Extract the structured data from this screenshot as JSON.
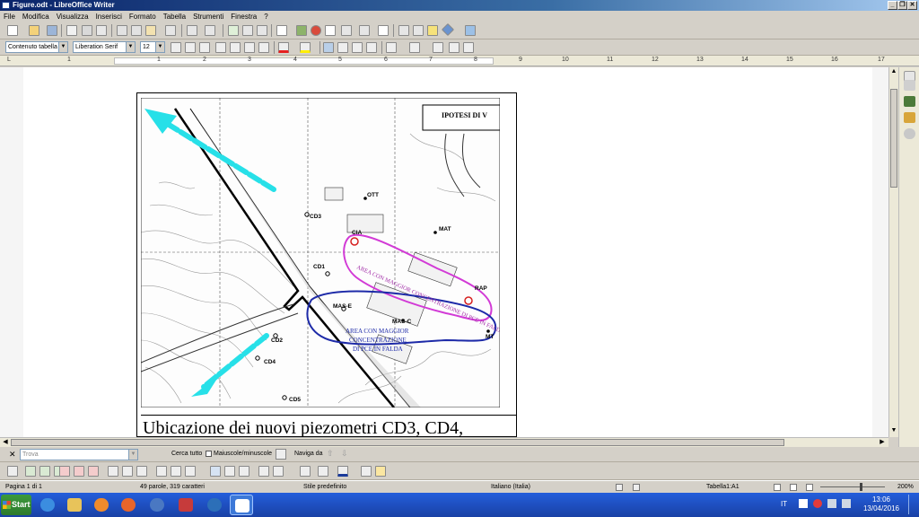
{
  "window": {
    "title": "Figure.odt - LibreOffice Writer",
    "minimize_label": "_",
    "maximize_label": "❐",
    "close_label": "✕"
  },
  "menu": [
    "File",
    "Modifica",
    "Visualizza",
    "Inserisci",
    "Formato",
    "Tabella",
    "Strumenti",
    "Finestra",
    "?"
  ],
  "formatting": {
    "paragraph_style": "Contenuto tabella",
    "font_name": "Liberation Serif",
    "font_size": "12"
  },
  "ruler": {
    "numbers": [
      "1",
      "1",
      "2",
      "3",
      "4",
      "5",
      "6",
      "7",
      "8",
      "9",
      "10",
      "11",
      "12",
      "13",
      "14",
      "15",
      "16",
      "17"
    ]
  },
  "document": {
    "caption": "Ubicazione dei nuovi piezometri CD3, CD4,",
    "map": {
      "header_label": "IPOTESI DI V",
      "wells": [
        "OTT",
        "CD3",
        "CIA",
        "MAT",
        "CD1",
        "RAP",
        "MAS-E",
        "MAS-C",
        "CD2",
        "CD4",
        "CD5",
        "MT"
      ],
      "purple_area_label": "AREA CON MAGGIOR CONCENTRAZIONE DI PCE IN FALDA",
      "blue_area_label_1": "AREA CON MAGGIOR",
      "blue_area_label_2": "CONCENTRAZIONE",
      "blue_area_label_3": "DI PCE IN FALDA"
    }
  },
  "findbar": {
    "placeholder": "Trova",
    "find_all": "Cerca tutto",
    "match_case": "Maiuscole/minuscole",
    "navigate_by": "Naviga da"
  },
  "status": {
    "page": "Pagina 1 di 1",
    "words": "49 parole, 319 caratteri",
    "page_style": "Stile predefinito",
    "language": "Italiano (Italia)",
    "cell": "Tabella1:A1",
    "zoom": "200%"
  },
  "taskbar": {
    "start_label": "Start",
    "language": "IT",
    "time": "13:06",
    "date": "13/04/2016"
  },
  "colors": {
    "cyan_arrow": "#27e0e8",
    "purple_contour": "#d23ad6",
    "blue_contour": "#1d2aa8"
  }
}
